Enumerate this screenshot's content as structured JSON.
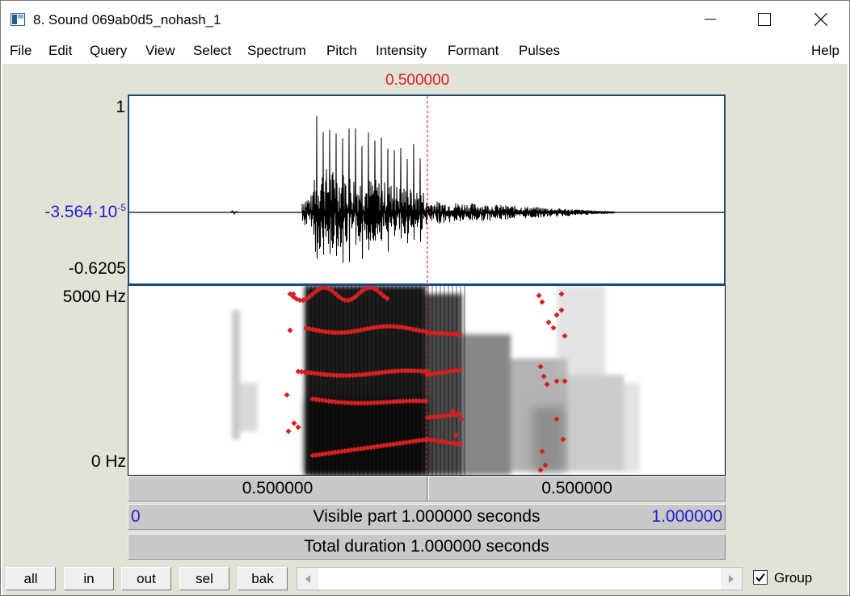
{
  "window": {
    "title": "8. Sound 069ab0d5_nohash_1",
    "icon": "praat-sound-window-icon",
    "controls": [
      "minimize-icon",
      "maximize-icon",
      "close-icon"
    ]
  },
  "menu": {
    "items": [
      "File",
      "Edit",
      "Query",
      "View",
      "Select",
      "Spectrum",
      "Pitch",
      "Intensity",
      "Formant",
      "Pulses"
    ],
    "help": "Help"
  },
  "editor": {
    "cursor_time": "0.500000",
    "waveform": {
      "amp_max": "1",
      "amp_zero_mantissa": "-3.564·10",
      "amp_zero_exp": "-5",
      "amp_min": "-0.6205"
    },
    "spectrogram": {
      "freq_max": "5000 Hz",
      "freq_min": "0 Hz",
      "formant_color": "#d42020"
    },
    "selection_bar": {
      "left": "0.500000",
      "right": "0.500000"
    },
    "visible_bar": {
      "start": "0",
      "text": "Visible part 1.000000 seconds",
      "end": "1.000000"
    },
    "total_bar": {
      "text": "Total duration 1.000000 seconds"
    }
  },
  "toolbar": {
    "all": "all",
    "in": "in",
    "out": "out",
    "sel": "sel",
    "bak": "bak",
    "group_label": "Group",
    "group_checked": true
  },
  "colors": {
    "cursor": "#e02020",
    "axis_blue": "#2020d0",
    "panel_bg": "#e3e2d6"
  }
}
